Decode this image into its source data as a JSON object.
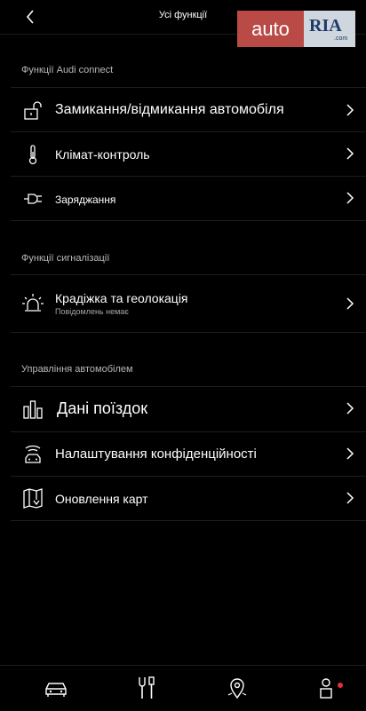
{
  "header": {
    "title": "Усі функції"
  },
  "watermark": {
    "auto": "auto",
    "ria": "RIA",
    "com": ".com"
  },
  "sections": {
    "audi_connect": {
      "label": "Функції Audi connect",
      "items": [
        {
          "label": "Замикання/відмикання автомобіля",
          "icon": "lock-icon"
        },
        {
          "label": "Клімат-контроль",
          "icon": "thermometer-icon"
        },
        {
          "label": "Заряджання",
          "icon": "charging-plug-icon"
        }
      ]
    },
    "alarm": {
      "label": "Функції сигналізації",
      "items": [
        {
          "label": "Крадіжка та геолокація",
          "sublabel": "Повідомлень немає",
          "icon": "alarm-beacon-icon"
        }
      ]
    },
    "vehicle": {
      "label": "Управління автомобілем",
      "items": [
        {
          "label": "Дані поїздок",
          "icon": "bar-chart-icon"
        },
        {
          "label": "Налаштування конфіденційності",
          "icon": "privacy-car-icon"
        },
        {
          "label": "Оновлення карт",
          "icon": "map-download-icon"
        }
      ]
    }
  },
  "bottom_nav": {
    "items": [
      {
        "icon": "car-icon"
      },
      {
        "icon": "tools-icon"
      },
      {
        "icon": "map-pin-icon"
      },
      {
        "icon": "profile-icon",
        "badge_color": "#e0323c"
      }
    ]
  }
}
